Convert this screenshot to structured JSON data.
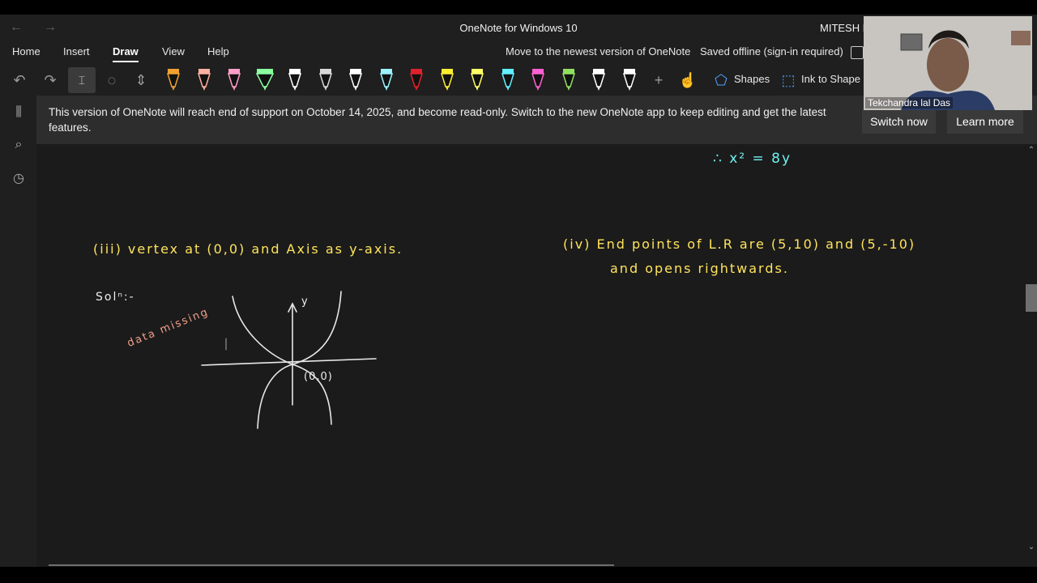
{
  "window": {
    "title": "OneNote for Windows 10",
    "user": "MITESH K"
  },
  "menu": {
    "items": [
      "Home",
      "Insert",
      "Draw",
      "View",
      "Help"
    ],
    "active": "Draw",
    "upgrade_link": "Move to the newest version of OneNote",
    "sync_status": "Saved offline (sign-in required)"
  },
  "toolbar": {
    "shapes_label": "Shapes",
    "ink_to_shape_label": "Ink to Shape",
    "pen_colors": [
      "#f0a030",
      "#ffb0a0",
      "#ff9ec8",
      "#8affa0",
      "#ffffff",
      "#d8d8d8",
      "#ffffff",
      "#9af3ff",
      "#e0202a",
      "#ffee30",
      "#ffff66",
      "#60f0ff",
      "#ff60d0",
      "#90e060",
      "#ffffff",
      "#ffffff"
    ]
  },
  "banner": {
    "message": "This version of OneNote will reach end of support on October 14, 2025, and become read-only. Switch to the new OneNote app to keep editing and get the latest features.",
    "switch_label": "Switch now",
    "learn_label": "Learn more"
  },
  "notes": {
    "result": "∴ x² = 8y",
    "q3": "(iii) vertex at (0,0) and Axis as y-axis.",
    "solution": "Solⁿ:-",
    "annotation": "data missing",
    "axis_label": "y",
    "origin_label": "(0,0)",
    "q4_line1": "(iv) End points of L.R are (5,10) and (5,-10)",
    "q4_line2": "and opens rightwards."
  },
  "webcam": {
    "name": "Tekchandra lal Das"
  }
}
